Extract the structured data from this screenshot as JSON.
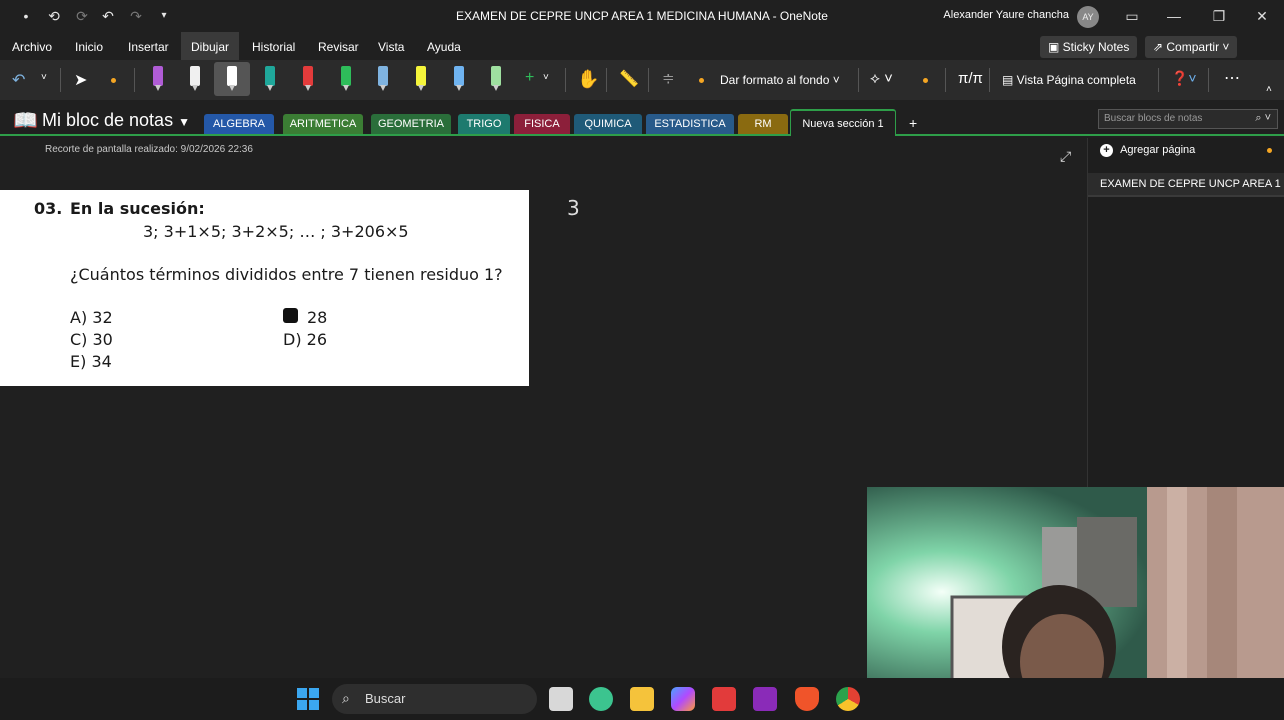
{
  "window": {
    "title": "EXAMEN DE CEPRE UNCP AREA 1 MEDICINA HUMANA  -  OneNote",
    "user": "Alexander Yaure chancha",
    "avatar_initials": "AY"
  },
  "menu": {
    "items": [
      "Archivo",
      "Inicio",
      "Insertar",
      "Dibujar",
      "Historial",
      "Revisar",
      "Vista",
      "Ayuda"
    ],
    "sticky_notes": "Sticky Notes",
    "share": "Compartir"
  },
  "toolbar": {
    "format_background": "Dar formato al fondo",
    "full_page_view": "Vista Página completa",
    "pens": [
      "#b05cd6",
      "#f0f0f0",
      "#ffffff",
      "#1fa79a",
      "#e33b3b",
      "#2ebd5a",
      "#7fb3e0",
      "#f5f53b",
      "#6fb3f0",
      "#9fe0a0"
    ]
  },
  "notebook": {
    "title": "Mi bloc de notas",
    "search_placeholder": "Buscar blocs de notas",
    "sections": [
      {
        "label": "ALGEBRA",
        "color": "#2458a8"
      },
      {
        "label": "ARITMETICA",
        "color": "#3b7d34"
      },
      {
        "label": "GEOMETRIA",
        "color": "#2a6e3a"
      },
      {
        "label": "TRIGO",
        "color": "#1d7a6e"
      },
      {
        "label": "FISICA",
        "color": "#8c1f3a"
      },
      {
        "label": "QUIMICA",
        "color": "#1f5a78"
      },
      {
        "label": "ESTADISTICA",
        "color": "#285a8a"
      },
      {
        "label": "RM",
        "color": "#8a6a10"
      },
      {
        "label": "Nueva sección 1",
        "color": "#202020"
      }
    ]
  },
  "page": {
    "snip_label": "Recorte de pantalla realizado: 9/02/2026 22:36",
    "ink_note": "3",
    "question": {
      "number": "03.",
      "intro": "En la sucesión:",
      "sequence": "3;  3+1×5;  3+2×5; … ;  3+206×5",
      "prompt": "¿Cuántos términos divididos entre 7 tienen residuo 1?",
      "options": {
        "a": "A) 32",
        "b": "28",
        "c": "C) 30",
        "d": "D) 26",
        "e": "E) 34"
      }
    }
  },
  "pages_panel": {
    "add_page": "Agregar página",
    "items": [
      "EXAMEN DE CEPRE UNCP AREA 1"
    ]
  },
  "taskbar": {
    "search": "Buscar"
  }
}
